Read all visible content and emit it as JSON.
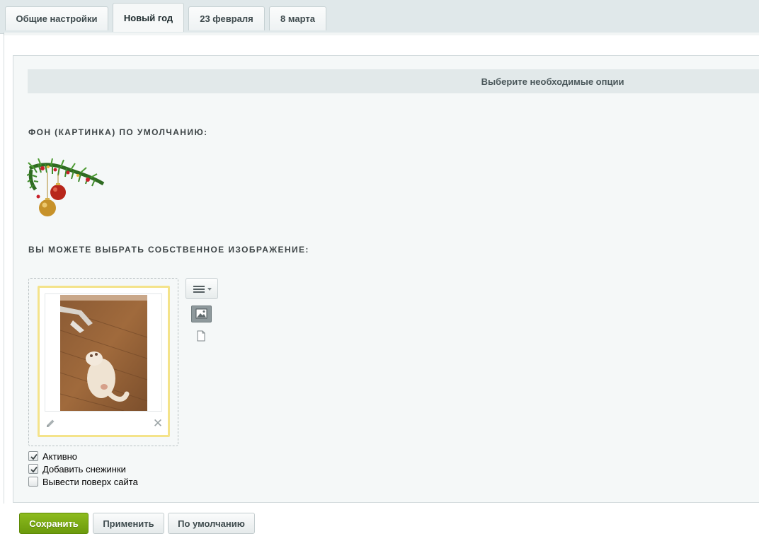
{
  "tabs": [
    {
      "label": "Общие настройки",
      "active": false
    },
    {
      "label": "Новый год",
      "active": true
    },
    {
      "label": "23 февраля",
      "active": false
    },
    {
      "label": "8 марта",
      "active": false
    }
  ],
  "section": {
    "header": "Выберите необходимые опции"
  },
  "fields": {
    "default_bg_label": "ФОН (КАРТИНКА) ПО УМОЛЧАНИЮ:",
    "custom_image_label": "ВЫ МОЖЕТЕ ВЫБРАТЬ СОБСТВЕННОЕ ИЗОБРАЖЕНИЕ:"
  },
  "options": [
    {
      "label": "Активно",
      "checked": true
    },
    {
      "label": "Добавить снежинки",
      "checked": true
    },
    {
      "label": "Вывести поверх сайта",
      "checked": false
    }
  ],
  "buttons": {
    "save": "Сохранить",
    "apply": "Применить",
    "default": "По умолчанию"
  },
  "icons": {
    "edit": "pencil-icon",
    "remove": "close-icon",
    "menu": "menu-icon",
    "image": "image-icon",
    "file": "file-icon"
  },
  "colors": {
    "primary_button": "#7aab14",
    "tab_bar": "#e0e8ea",
    "panel_bg": "#f5f8f8",
    "card_border": "#f4e38a"
  }
}
